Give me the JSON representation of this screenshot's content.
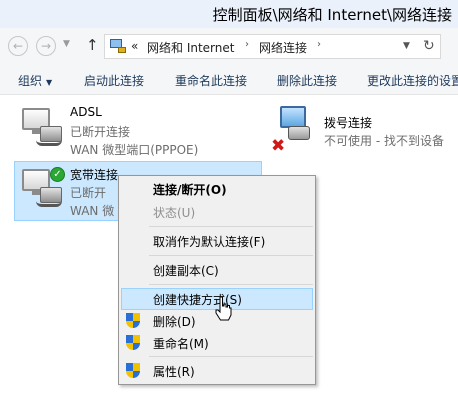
{
  "window": {
    "title": "控制面板\\网络和 Internet\\网络连接"
  },
  "address_bar": {
    "overflow": "«",
    "crumbs": [
      "网络和 Internet",
      "网络连接"
    ],
    "separator": "›"
  },
  "toolbar": {
    "organize": "组织",
    "start": "启动此连接",
    "rename": "重命名此连接",
    "delete": "删除此连接",
    "change": "更改此连接的设置"
  },
  "connections": [
    {
      "name": "ADSL",
      "status": "已断开连接",
      "device": "WAN 微型端口(PPPOE)"
    },
    {
      "name": "拨号连接",
      "status": "不可使用 - 找不到设备"
    },
    {
      "name": "宽带连接",
      "status": "已断开",
      "device": "WAN 微"
    }
  ],
  "context_menu": {
    "items": [
      {
        "label": "连接/断开(O)",
        "bold": true
      },
      {
        "label": "状态(U)",
        "disabled": true
      },
      {
        "label": "取消作为默认连接(F)"
      },
      {
        "label": "创建副本(C)"
      },
      {
        "label": "创建快捷方式(S)",
        "hover": true
      },
      {
        "label": "删除(D)",
        "shield": true
      },
      {
        "label": "重命名(M)",
        "shield": true
      },
      {
        "label": "属性(R)",
        "shield": true
      }
    ]
  },
  "icons": {
    "back": "back-arrow-icon",
    "forward": "forward-arrow-icon",
    "up": "up-arrow-icon",
    "refresh": "refresh-icon",
    "shield": "uac-shield-icon",
    "check": "check-badge-icon",
    "error": "red-x-icon"
  },
  "colors": {
    "selection": "#cce8ff",
    "selection_border": "#99d1ff",
    "menu_bg": "#f0f0f0",
    "error_red": "#d01818",
    "connected_green": "#2aa833"
  }
}
